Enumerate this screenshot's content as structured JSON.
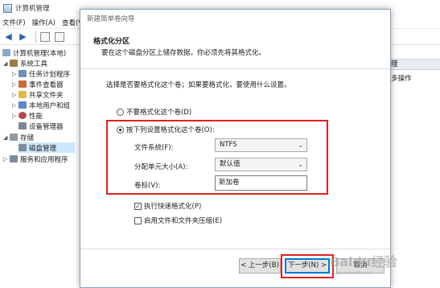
{
  "window": {
    "title": "计算机管理"
  },
  "menubar": [
    "文件(F)",
    "操作(A)",
    "查看(V)"
  ],
  "tree": {
    "root": "计算机管理(本地)",
    "system_tools": "系统工具",
    "task_scheduler": "任务计划程序",
    "event_viewer": "事件查看器",
    "shared_folders": "共享文件夹",
    "local_users": "本地用户和组",
    "performance": "性能",
    "device_manager": "设备管理器",
    "storage": "存储",
    "disk_management": "磁盘管理",
    "services": "服务和应用程序"
  },
  "actions": {
    "header": "理",
    "more": "多操作"
  },
  "wizard": {
    "title": "新建简单卷向导",
    "header_title": "格式化分区",
    "header_subtitle": "要在这个磁盘分区上储存数据，你必须先将其格式化。",
    "prompt": "选择是否要格式化这个卷；如果要格式化，要使用什么设置。",
    "radio_no_format": "不要格式化这个卷(D)",
    "radio_format": "按下列设置格式化这个卷(O):",
    "fs_label": "文件系统(F):",
    "fs_value": "NTFS",
    "alloc_label": "分配单元大小(A):",
    "alloc_value": "默认值",
    "volume_label": "卷标(V):",
    "volume_value": "新加卷",
    "quick_format": "执行快速格式化(P)",
    "compression": "启用文件和文件夹压缩(E)",
    "back_button": "< 上一步(B)",
    "next_button": "下一步(N) >",
    "cancel_button": "取消"
  },
  "watermark": {
    "brand": "Baidu经验",
    "url": "jingyan.baidu.com"
  },
  "colors": {
    "highlight_red": "#e02020",
    "selection": "#cce8ff",
    "accent": "#0078d7"
  }
}
